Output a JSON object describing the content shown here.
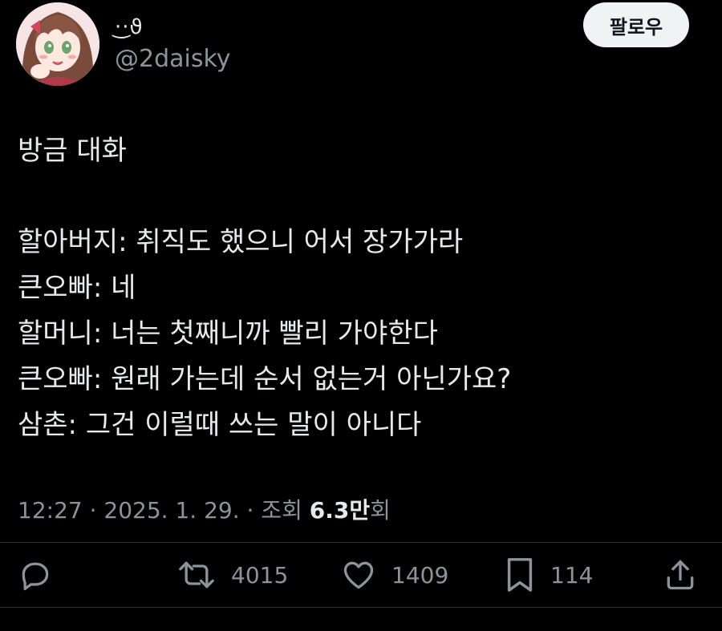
{
  "user": {
    "display_name": "◌͡฾͡◌",
    "display_name_visible": "·͜·ϑ",
    "handle": "@2daisky",
    "follow_label": "팔로우"
  },
  "tweet": {
    "lines": [
      "방금 대화",
      "",
      "할아버지: 취직도 했으니 어서 장가가라",
      "큰오빠: 네",
      "할머니: 너는 첫째니까 빨리 가야한다",
      "큰오빠: 원래 가는데 순서 없는거 아닌가요?",
      "삼촌: 그건 이럴때 쓰는 말이 아니다"
    ]
  },
  "meta": {
    "time": "12:27",
    "separator": " · ",
    "date": "2025. 1. 29.",
    "views_prefix": "조회 ",
    "views_count": "6.3만",
    "views_suffix": "회"
  },
  "actions": {
    "reply": {
      "icon": "reply-icon",
      "count": ""
    },
    "retweet": {
      "icon": "retweet-icon",
      "count": "4015"
    },
    "like": {
      "icon": "heart-icon",
      "count": "1409"
    },
    "bookmark": {
      "icon": "bookmark-icon",
      "count": "114"
    },
    "share": {
      "icon": "share-icon",
      "count": ""
    }
  },
  "colors": {
    "background": "#000000",
    "text_primary": "#e7e9ea",
    "text_secondary": "#8b949a",
    "follow_button_bg": "#eff3f4",
    "follow_button_text": "#0f1419",
    "divider": "#2f3336"
  }
}
